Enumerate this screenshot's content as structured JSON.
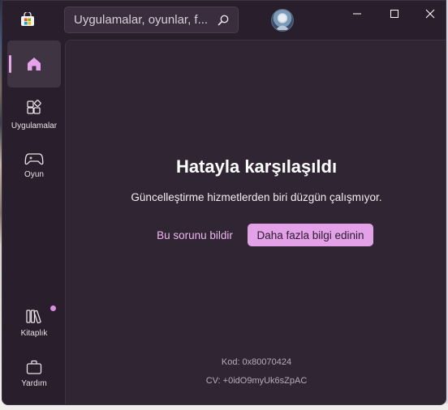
{
  "search": {
    "placeholder": "Uygulamalar, oyunlar, f..."
  },
  "sidebar": {
    "items": [
      {
        "id": "home",
        "label": ""
      },
      {
        "id": "apps",
        "label": "Uygulamalar"
      },
      {
        "id": "gaming",
        "label": "Oyun"
      },
      {
        "id": "library",
        "label": "Kitaplık"
      },
      {
        "id": "help",
        "label": "Yardım"
      }
    ]
  },
  "error": {
    "title": "Hatayla karşılaşıldı",
    "description": "Güncelleştirme hizmetlerden biri düzgün çalışmıyor.",
    "report_label": "Bu sorunu bildir",
    "learn_more_label": "Daha fazla bilgi edinin",
    "code": "Kod: 0x80070424",
    "cv": "CV: +0idO9myUk6sZpAC"
  },
  "colors": {
    "accent": "#e3a2e8",
    "background": "#2f2533",
    "sidebar": "#281e2c"
  },
  "icons": {
    "app": "microsoft-store-icon",
    "search": "search-icon",
    "minimize": "minimize-icon",
    "maximize": "maximize-icon",
    "close": "close-icon",
    "home": "home-icon",
    "apps": "apps-icon",
    "gaming": "gamepad-icon",
    "library": "library-icon",
    "help": "help-icon"
  }
}
